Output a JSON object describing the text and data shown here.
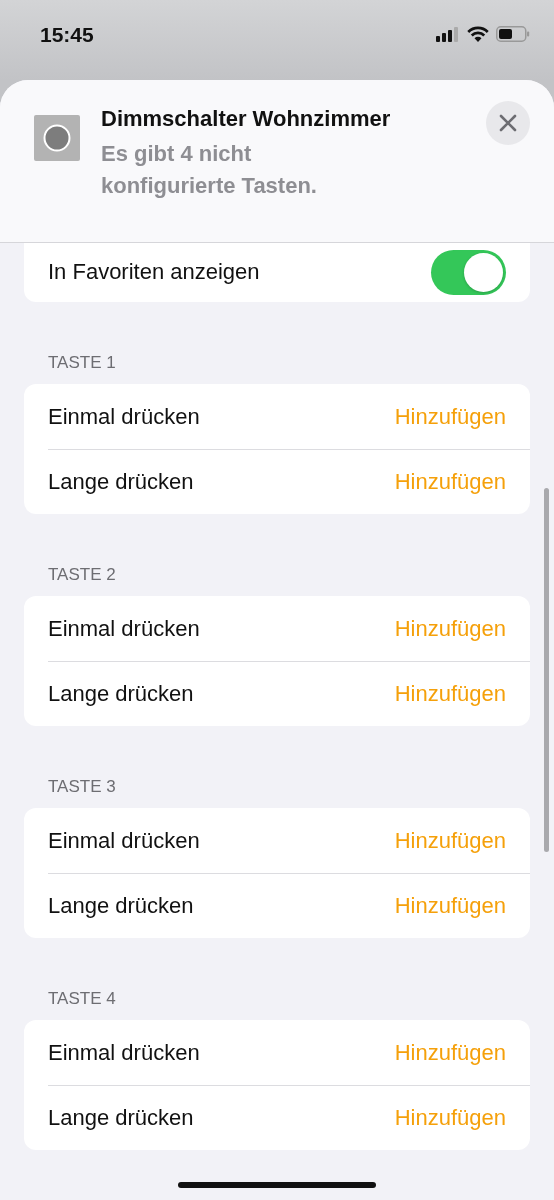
{
  "status_bar": {
    "time": "15:45"
  },
  "header": {
    "title": "Dimmschalter Wohnzimmer",
    "subtitle": "Es gibt 4 nicht konfigurierte Tasten."
  },
  "favorites": {
    "label": "In Favoriten anzeigen",
    "on": true
  },
  "sections": [
    {
      "title": "TASTE 1",
      "rows": [
        {
          "label": "Einmal drücken",
          "action": "Hinzufügen"
        },
        {
          "label": "Lange drücken",
          "action": "Hinzufügen"
        }
      ]
    },
    {
      "title": "TASTE 2",
      "rows": [
        {
          "label": "Einmal drücken",
          "action": "Hinzufügen"
        },
        {
          "label": "Lange drücken",
          "action": "Hinzufügen"
        }
      ]
    },
    {
      "title": "TASTE 3",
      "rows": [
        {
          "label": "Einmal drücken",
          "action": "Hinzufügen"
        },
        {
          "label": "Lange drücken",
          "action": "Hinzufügen"
        }
      ]
    },
    {
      "title": "TASTE 4",
      "rows": [
        {
          "label": "Einmal drücken",
          "action": "Hinzufügen"
        },
        {
          "label": "Lange drücken",
          "action": "Hinzufügen"
        }
      ]
    }
  ]
}
